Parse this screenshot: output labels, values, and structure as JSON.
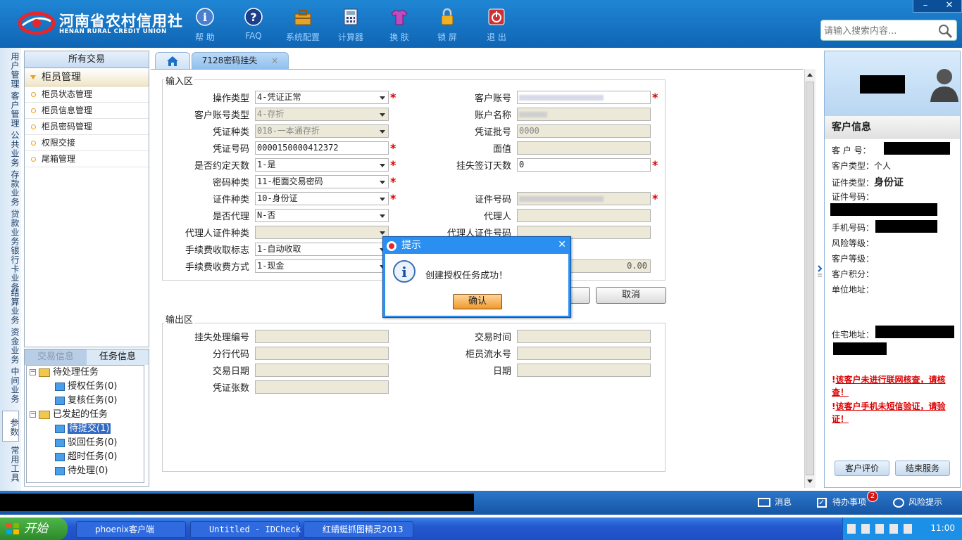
{
  "brand": {
    "name_cn": "河南省农村信用社",
    "name_en": "HENAN RURAL CREDIT UNION"
  },
  "toolbar": [
    {
      "label": "帮 助",
      "icon": "info-icon"
    },
    {
      "label": "FAQ",
      "icon": "question-icon"
    },
    {
      "label": "系统配置",
      "icon": "toolbox-icon"
    },
    {
      "label": "计算器",
      "icon": "calculator-icon"
    },
    {
      "label": "换 肤",
      "icon": "shirt-icon"
    },
    {
      "label": "锁 屏",
      "icon": "lock-icon"
    },
    {
      "label": "退 出",
      "icon": "power-icon"
    }
  ],
  "window_controls": {
    "minimize": "–",
    "close": "✕"
  },
  "search": {
    "placeholder": "请输入搜索内容..."
  },
  "vnav": [
    "用户管理",
    "客户管理",
    "公共业务",
    "存款业务",
    "贷款业务",
    "银行卡业务",
    "结算业务",
    "资金业务",
    "中间业务",
    "参数",
    "常用工具"
  ],
  "left_menu": {
    "header": "所有交易",
    "section": "柜员管理",
    "items": [
      "柜员状态管理",
      "柜员信息管理",
      "柜员密码管理",
      "权限交接",
      "尾箱管理"
    ]
  },
  "task_panel": {
    "tabs": [
      "交易信息",
      "任务信息"
    ],
    "tree": {
      "pending_group": "待处理任务",
      "pending_items": [
        "授权任务(0)",
        "复核任务(0)"
      ],
      "initiated_group": "已发起的任务",
      "initiated_items": [
        "待提交(1)",
        "驳回任务(0)",
        "超时任务(0)",
        "待处理(0)"
      ]
    }
  },
  "tabs": {
    "active": "7128密码挂失",
    "close": "×"
  },
  "input_area": {
    "title": "输入区",
    "left": [
      {
        "label": "操作类型",
        "value": "4-凭证正常"
      },
      {
        "label": "客户账号类型",
        "value": "4-存折"
      },
      {
        "label": "凭证种类",
        "value": "018-一本通存折"
      },
      {
        "label": "凭证号码",
        "value": "0000150000412372"
      },
      {
        "label": "是否约定天数",
        "value": "1-是"
      },
      {
        "label": "密码种类",
        "value": "11-柜面交易密码"
      },
      {
        "label": "证件种类",
        "value": "10-身份证"
      },
      {
        "label": "是否代理",
        "value": "N-否"
      },
      {
        "label": "代理人证件种类",
        "value": ""
      },
      {
        "label": "手续费收取标志",
        "value": "1-自动收取"
      },
      {
        "label": "手续费收费方式",
        "value": "1-现金"
      }
    ],
    "right": [
      {
        "label": "客户账号",
        "value": ""
      },
      {
        "label": "账户名称",
        "value": ""
      },
      {
        "label": "凭证批号",
        "value": "0000"
      },
      {
        "label": "面值",
        "value": ""
      },
      {
        "label": "挂失签订天数",
        "value": "0"
      },
      {
        "label": "证件号码",
        "value": ""
      },
      {
        "label": "代理人",
        "value": ""
      },
      {
        "label": "代理人证件号码",
        "value": ""
      }
    ],
    "fee_amount": "0.00",
    "required_mark": "*"
  },
  "buttons": {
    "cancel": "取消"
  },
  "output_area": {
    "title": "输出区",
    "left": [
      "挂失处理编号",
      "分行代码",
      "交易日期",
      "凭证张数"
    ],
    "right": [
      "交易时间",
      "柜员流水号",
      "日期"
    ]
  },
  "dialog": {
    "title": "提示",
    "message": "创建授权任务成功！",
    "ok": "确认",
    "close": "✕"
  },
  "customer": {
    "header": "客户信息",
    "customer_no_label": "客 户 号：",
    "customer_type_label": "客户类型：",
    "customer_type": "个人",
    "id_type_label": "证件类型：",
    "id_type": "身份证",
    "id_no_label": "证件号码：",
    "phone_label": "手机号码：",
    "risk_label": "风险等级：",
    "level_label": "客户等级：",
    "points_label": "客户积分：",
    "company_label": "单位地址：",
    "home_label": "住宅地址：",
    "warning1": "该客户未进行联网核查，请核查！",
    "warning2": "该客户手机未短信验证，请验证！",
    "btn_eval": "客户评价",
    "btn_end": "结束服务"
  },
  "status_bar": {
    "messages": "消息",
    "todo": "待办事项",
    "todo_count": "2",
    "risk": "风险提示"
  },
  "taskbar": {
    "start": "开始",
    "items": [
      "phoenix客户端",
      "Untitled - IDCheck",
      "红蜻蜓抓图精灵2013"
    ],
    "clock": "11:00"
  }
}
